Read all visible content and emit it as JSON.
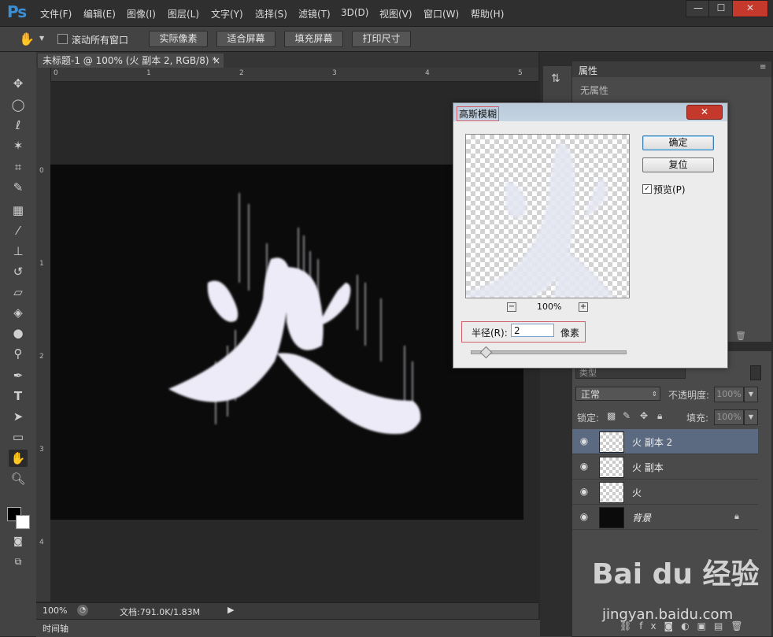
{
  "app": {
    "logo": "Ps",
    "menus": [
      "文件(F)",
      "编辑(E)",
      "图像(I)",
      "图层(L)",
      "文字(Y)",
      "选择(S)",
      "滤镜(T)",
      "3D(D)",
      "视图(V)",
      "窗口(W)",
      "帮助(H)"
    ],
    "window_controls": [
      "—",
      "☐",
      "✕"
    ]
  },
  "options_bar": {
    "scroll_all_label": "滚动所有窗口",
    "buttons": [
      "实际像素",
      "适合屏幕",
      "填充屏幕",
      "打印尺寸"
    ]
  },
  "document": {
    "tab_title": "未标题-1 @ 100% (火 副本 2, RGB/8) *",
    "tab_close": "×",
    "canvas_char": "火",
    "ruler_top": [
      "0",
      "1",
      "2",
      "3",
      "4",
      "5"
    ],
    "ruler_left": [
      "0",
      "1",
      "2",
      "3",
      "4"
    ]
  },
  "status_bar": {
    "zoom": "100%",
    "doc_info": "文档:791.0K/1.83M"
  },
  "timeline_label": "时间轴",
  "properties_panel": {
    "tab": "属性",
    "content": "无属性"
  },
  "layers_panel": {
    "kind_placeholder": "类型",
    "blend_mode": "正常",
    "opacity_label": "不透明度:",
    "opacity_value": "100%",
    "lock_label": "锁定:",
    "fill_label": "填充:",
    "fill_value": "100%",
    "layers": [
      {
        "name": "火 副本 2",
        "selected": true
      },
      {
        "name": "火 副本",
        "selected": false
      },
      {
        "name": "火",
        "selected": false
      },
      {
        "name": "背景",
        "selected": false
      }
    ]
  },
  "dialog": {
    "title": "高斯模糊",
    "ok": "确定",
    "reset": "复位",
    "preview_label": "预览(P)",
    "preview_checked": true,
    "zoom": "100%",
    "zoom_minus": "−",
    "zoom_plus": "+",
    "radius_label": "半径(R):",
    "radius_value": "2",
    "radius_unit": "像素",
    "close": "✕"
  },
  "watermark": {
    "brand": "Bai du 经验",
    "url": "jingyan.baidu.com"
  }
}
